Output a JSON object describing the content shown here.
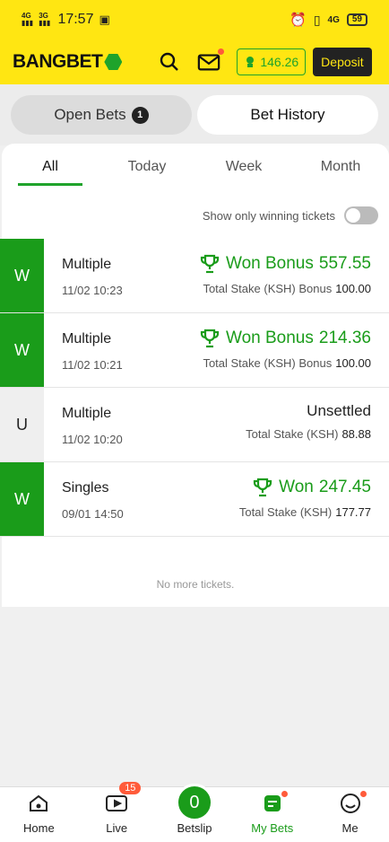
{
  "status_bar": {
    "time": "17:57",
    "network_left_1": "4G",
    "network_left_2": "3G",
    "network_right": "4G",
    "battery": "59"
  },
  "header": {
    "logo_text": "BANGBET",
    "balance": "146.26",
    "deposit_label": "Deposit"
  },
  "tabs": {
    "open_bets_label": "Open Bets",
    "open_bets_count": "1",
    "bet_history_label": "Bet History"
  },
  "filters": [
    {
      "label": "All"
    },
    {
      "label": "Today"
    },
    {
      "label": "Week"
    },
    {
      "label": "Month"
    }
  ],
  "winning_toggle_label": "Show only winning tickets",
  "tickets": [
    {
      "status": "W",
      "type": "Multiple",
      "date": "11/02 10:23",
      "result": "Won Bonus",
      "amount": "557.55",
      "stake_label": "Total Stake (KSH) Bonus",
      "stake_value": "100.00"
    },
    {
      "status": "W",
      "type": "Multiple",
      "date": "11/02 10:21",
      "result": "Won Bonus",
      "amount": "214.36",
      "stake_label": "Total Stake (KSH) Bonus",
      "stake_value": "100.00"
    },
    {
      "status": "U",
      "type": "Multiple",
      "date": "11/02 10:20",
      "result": "Unsettled",
      "amount": "",
      "stake_label": "Total Stake (KSH)",
      "stake_value": "88.88"
    },
    {
      "status": "W",
      "type": "Singles",
      "date": "09/01 14:50",
      "result": "Won",
      "amount": "247.45",
      "stake_label": "Total Stake (KSH)",
      "stake_value": "177.77"
    }
  ],
  "no_more_text": "No more tickets.",
  "bottom_nav": {
    "home": "Home",
    "live": "Live",
    "live_badge": "15",
    "betslip": "Betslip",
    "betslip_count": "0",
    "mybets": "My Bets",
    "me": "Me"
  },
  "colors": {
    "brand_yellow": "#ffe612",
    "brand_green": "#1a9c1a",
    "dark": "#222222",
    "notification_red": "#ff5b3a"
  }
}
